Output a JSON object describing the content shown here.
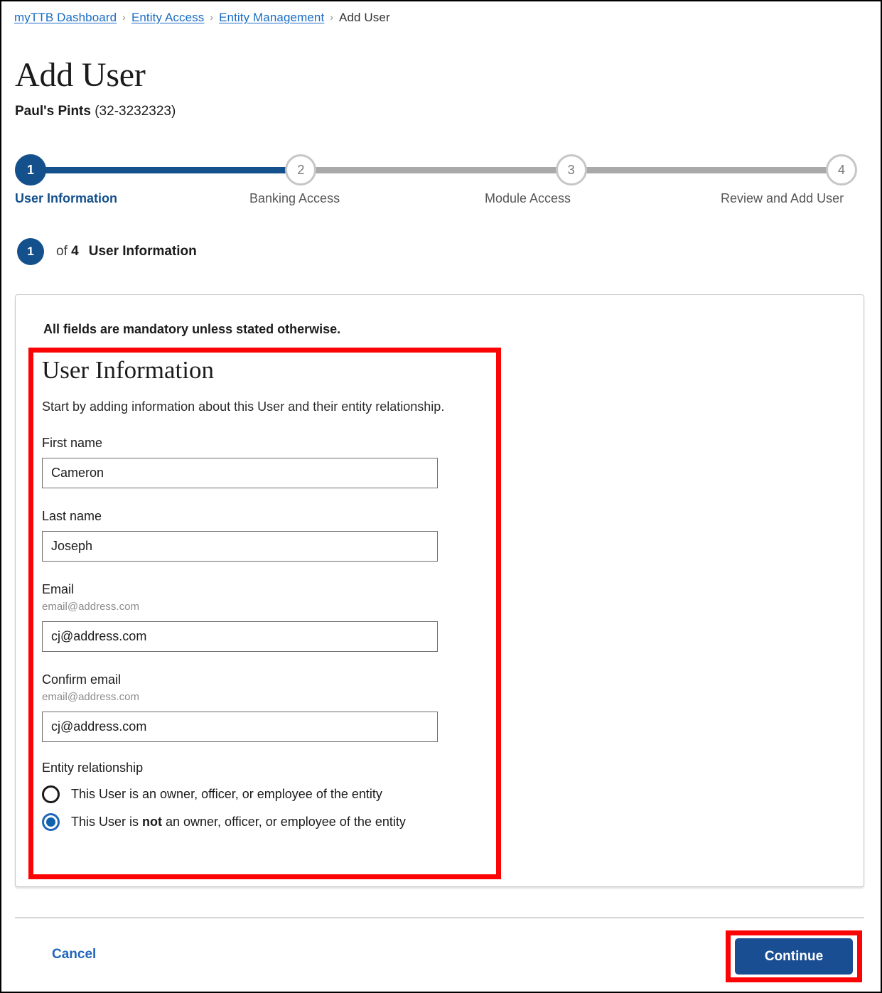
{
  "breadcrumb": {
    "items": [
      {
        "label": "myTTB Dashboard",
        "link": true
      },
      {
        "label": "Entity Access",
        "link": true
      },
      {
        "label": "Entity Management",
        "link": true
      },
      {
        "label": "Add User",
        "link": false
      }
    ],
    "separator": "›"
  },
  "header": {
    "title": "Add User",
    "entity_name": "Paul's Pints",
    "entity_number": "(32-3232323)"
  },
  "stepper": {
    "steps": [
      {
        "number": "1",
        "label": "User Information",
        "state": "active"
      },
      {
        "number": "2",
        "label": "Banking Access",
        "state": "inactive"
      },
      {
        "number": "3",
        "label": "Module Access",
        "state": "inactive"
      },
      {
        "number": "4",
        "label": "Review and Add User",
        "state": "inactive"
      }
    ]
  },
  "step_heading": {
    "badge": "1",
    "of_text": "of",
    "total": "4",
    "name": "User Information"
  },
  "card": {
    "mandatory_note": "All fields are mandatory unless stated otherwise.",
    "form_title": "User Information",
    "form_description": "Start by adding information about this User and their entity relationship.",
    "fields": [
      {
        "label": "First name",
        "hint": "",
        "value": "Cameron",
        "placeholder": ""
      },
      {
        "label": "Last name",
        "hint": "",
        "value": "Joseph",
        "placeholder": ""
      },
      {
        "label": "Email",
        "hint": "email@address.com",
        "value": "cj@address.com",
        "placeholder": ""
      },
      {
        "label": "Confirm email",
        "hint": "email@address.com",
        "value": "cj@address.com",
        "placeholder": ""
      }
    ],
    "relationship": {
      "label": "Entity relationship",
      "options": [
        {
          "text_before": "This User is an owner, officer, or employee of the entity",
          "emphasis": "",
          "text_after": "",
          "selected": false
        },
        {
          "text_before": "This User is ",
          "emphasis": "not",
          "text_after": " an owner, officer, or employee of the entity",
          "selected": true
        }
      ]
    }
  },
  "footer": {
    "cancel_label": "Cancel",
    "continue_label": "Continue"
  },
  "colors": {
    "primary_blue": "#14508c",
    "link_blue": "#1a6cc4",
    "button_blue": "#1a4e93",
    "highlight_red": "#fb0405",
    "inactive_gray": "#a9a9a9"
  }
}
